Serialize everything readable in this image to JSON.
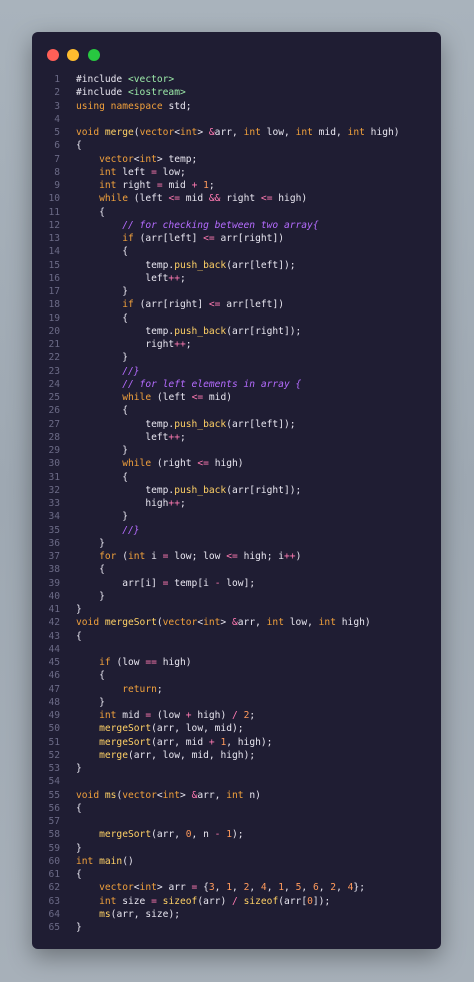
{
  "window": {
    "controls": [
      "close",
      "minimize",
      "maximize"
    ],
    "colors": {
      "close": "#ff5f57",
      "minimize": "#febc2e",
      "maximize": "#28c840",
      "background": "#1f1d33"
    }
  },
  "code": {
    "lines": [
      {
        "n": "1",
        "t": "#include <vector>"
      },
      {
        "n": "2",
        "t": "#include <iostream>"
      },
      {
        "n": "3",
        "t": "using namespace std;"
      },
      {
        "n": "4",
        "t": ""
      },
      {
        "n": "5",
        "t": "void merge(vector<int> &arr, int low, int mid, int high)"
      },
      {
        "n": "6",
        "t": "{"
      },
      {
        "n": "7",
        "t": "    vector<int> temp;"
      },
      {
        "n": "8",
        "t": "    int left = low;"
      },
      {
        "n": "9",
        "t": "    int right = mid + 1;"
      },
      {
        "n": "10",
        "t": "    while (left <= mid && right <= high)"
      },
      {
        "n": "11",
        "t": "    {"
      },
      {
        "n": "12",
        "t": "        // for checking between two array{"
      },
      {
        "n": "13",
        "t": "        if (arr[left] <= arr[right])"
      },
      {
        "n": "14",
        "t": "        {"
      },
      {
        "n": "15",
        "t": "            temp.push_back(arr[left]);"
      },
      {
        "n": "16",
        "t": "            left++;"
      },
      {
        "n": "17",
        "t": "        }"
      },
      {
        "n": "18",
        "t": "        if (arr[right] <= arr[left])"
      },
      {
        "n": "19",
        "t": "        {"
      },
      {
        "n": "20",
        "t": "            temp.push_back(arr[right]);"
      },
      {
        "n": "21",
        "t": "            right++;"
      },
      {
        "n": "22",
        "t": "        }"
      },
      {
        "n": "23",
        "t": "        //}"
      },
      {
        "n": "24",
        "t": "        // for left elements in array {"
      },
      {
        "n": "25",
        "t": "        while (left <= mid)"
      },
      {
        "n": "26",
        "t": "        {"
      },
      {
        "n": "27",
        "t": "            temp.push_back(arr[left]);"
      },
      {
        "n": "28",
        "t": "            left++;"
      },
      {
        "n": "29",
        "t": "        }"
      },
      {
        "n": "30",
        "t": "        while (right <= high)"
      },
      {
        "n": "31",
        "t": "        {"
      },
      {
        "n": "32",
        "t": "            temp.push_back(arr[right]);"
      },
      {
        "n": "33",
        "t": "            high++;"
      },
      {
        "n": "34",
        "t": "        }"
      },
      {
        "n": "35",
        "t": "        //}"
      },
      {
        "n": "36",
        "t": "    }"
      },
      {
        "n": "37",
        "t": "    for (int i = low; low <= high; i++)"
      },
      {
        "n": "38",
        "t": "    {"
      },
      {
        "n": "39",
        "t": "        arr[i] = temp[i - low];"
      },
      {
        "n": "40",
        "t": "    }"
      },
      {
        "n": "41",
        "t": "}"
      },
      {
        "n": "42",
        "t": "void mergeSort(vector<int> &arr, int low, int high)"
      },
      {
        "n": "43",
        "t": "{"
      },
      {
        "n": "44",
        "t": ""
      },
      {
        "n": "45",
        "t": "    if (low == high)"
      },
      {
        "n": "46",
        "t": "    {"
      },
      {
        "n": "47",
        "t": "        return;"
      },
      {
        "n": "48",
        "t": "    }"
      },
      {
        "n": "49",
        "t": "    int mid = (low + high) / 2;"
      },
      {
        "n": "50",
        "t": "    mergeSort(arr, low, mid);"
      },
      {
        "n": "51",
        "t": "    mergeSort(arr, mid + 1, high);"
      },
      {
        "n": "52",
        "t": "    merge(arr, low, mid, high);"
      },
      {
        "n": "53",
        "t": "}"
      },
      {
        "n": "54",
        "t": ""
      },
      {
        "n": "55",
        "t": "void ms(vector<int> &arr, int n)"
      },
      {
        "n": "56",
        "t": "{"
      },
      {
        "n": "57",
        "t": ""
      },
      {
        "n": "58",
        "t": "    mergeSort(arr, 0, n - 1);"
      },
      {
        "n": "59",
        "t": "}"
      },
      {
        "n": "60",
        "t": "int main()"
      },
      {
        "n": "61",
        "t": "{"
      },
      {
        "n": "62",
        "t": "    vector<int> arr = {3, 1, 2, 4, 1, 5, 6, 2, 4};"
      },
      {
        "n": "63",
        "t": "    int size = sizeof(arr) / sizeof(arr[0]);"
      },
      {
        "n": "64",
        "t": "    ms(arr, size);"
      },
      {
        "n": "65",
        "t": "}"
      }
    ]
  }
}
